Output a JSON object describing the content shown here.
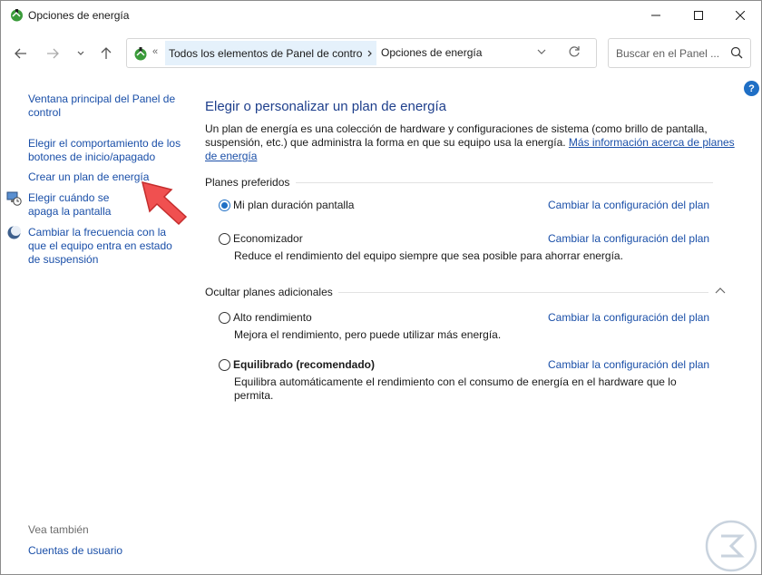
{
  "window": {
    "title": "Opciones de energía"
  },
  "address": {
    "root_prefix": "«",
    "crumb1": "Todos los elementos de Panel de control",
    "crumb2": "Opciones de energía"
  },
  "search": {
    "placeholder": "Buscar en el Panel ..."
  },
  "sidebar": {
    "items": [
      {
        "label": "Ventana principal del Panel de control",
        "icon": null
      },
      {
        "label": "Elegir el comportamiento de los botones de inicio/apagado",
        "icon": null
      },
      {
        "label": "Crear un plan de energía",
        "icon": null
      },
      {
        "label": "Elegir cuándo se apaga la pantalla",
        "icon": "display-clock-icon"
      },
      {
        "label": "Cambiar la frecuencia con la que el equipo entra en estado de suspensión",
        "icon": "moon-icon"
      }
    ],
    "see_also": "Vea también",
    "user_accounts": "Cuentas de usuario"
  },
  "main": {
    "title": "Elegir o personalizar un plan de energía",
    "intro": "Un plan de energía es una colección de hardware y configuraciones de sistema (como brillo de pantalla, suspensión, etc.) que administra la forma en que su equipo usa la energía.",
    "intro_link": "Más información acerca de planes de energía",
    "preferred_header": "Planes preferidos",
    "additional_header": "Ocultar planes adicionales",
    "preferred_plans": [
      {
        "name": "Mi plan duración pantalla",
        "selected": true,
        "bold": false,
        "change": "Cambiar la configuración del plan",
        "desc": ""
      },
      {
        "name": "Economizador",
        "selected": false,
        "bold": false,
        "change": "Cambiar la configuración del plan",
        "desc": "Reduce el rendimiento del equipo siempre que sea posible para ahorrar energía."
      }
    ],
    "additional_plans": [
      {
        "name": "Alto rendimiento",
        "selected": false,
        "bold": false,
        "change": "Cambiar la configuración del plan",
        "desc": "Mejora el rendimiento, pero puede utilizar más energía."
      },
      {
        "name": "Equilibrado (recomendado)",
        "selected": false,
        "bold": true,
        "change": "Cambiar la configuración del plan",
        "desc": "Equilibra automáticamente el rendimiento con el consumo de energía en el hardware que lo permita."
      }
    ]
  },
  "colors": {
    "link": "#1a4fa8",
    "title": "#1e3f8c",
    "accent": "#1f6fc5",
    "arrow": "#f05050"
  }
}
